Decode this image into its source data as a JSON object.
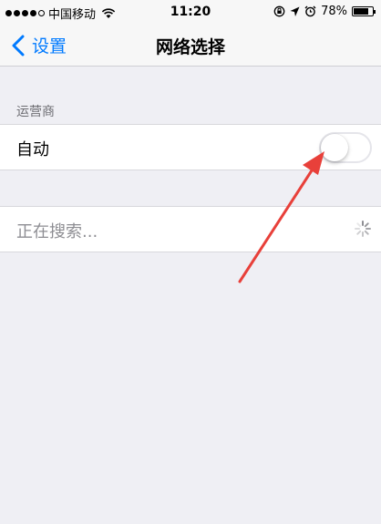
{
  "status_bar": {
    "carrier": "中国移动",
    "time": "11:20",
    "battery": "78%",
    "battery_level": 0.78,
    "icons": [
      "signal-dots",
      "wifi-icon",
      "rotation-lock-icon",
      "location-icon",
      "alarm-icon",
      "battery-icon"
    ]
  },
  "nav": {
    "back_label": "设置",
    "title": "网络选择"
  },
  "section": {
    "header": "运营商"
  },
  "auto_row": {
    "label": "自动",
    "toggle_on": false
  },
  "search_row": {
    "label": "正在搜索..."
  },
  "colors": {
    "accent": "#007aff",
    "background": "#efeff4",
    "annotation_arrow": "#e8403a"
  }
}
